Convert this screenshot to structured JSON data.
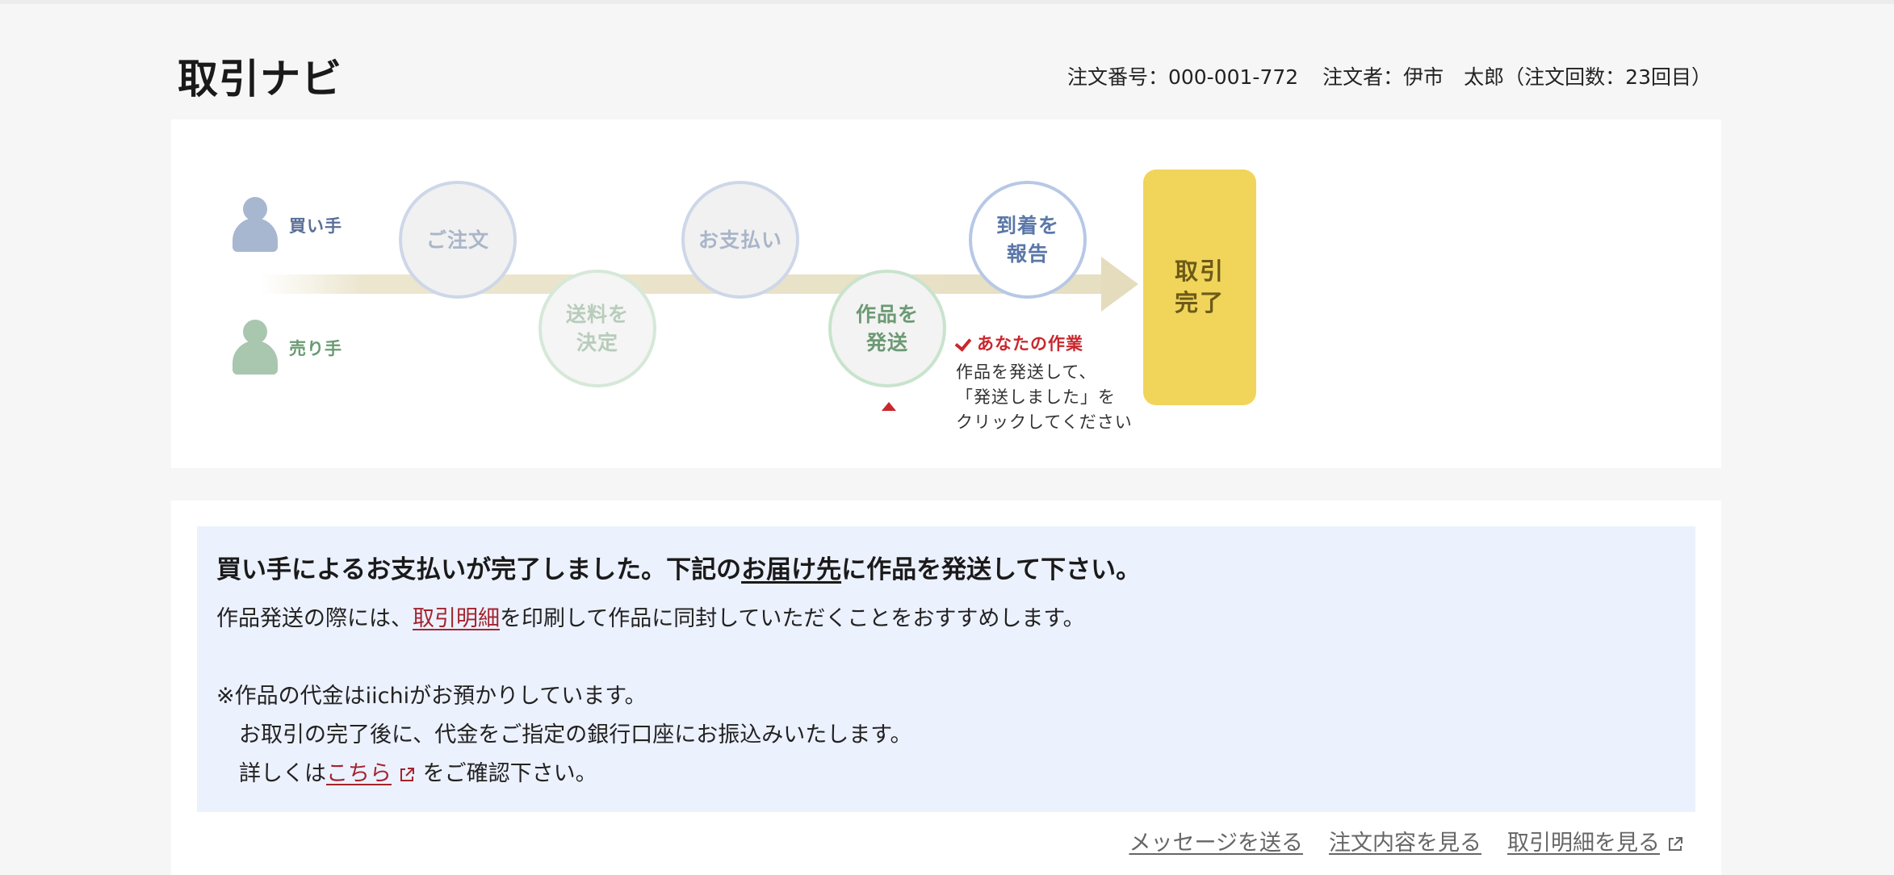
{
  "header": {
    "title": "取引ナビ",
    "order_number": "注文番号：000-001-772",
    "orderer": "注文者：伊市　太郎（注文回数：23回目）"
  },
  "flow": {
    "buyer_label": "買い手",
    "seller_label": "売り手",
    "steps": [
      {
        "label": "ご注文",
        "role": "buyer"
      },
      {
        "label": "送料を\n決定",
        "role": "seller"
      },
      {
        "label": "お支払い",
        "role": "buyer"
      },
      {
        "label": "作品を\n発送",
        "role": "seller",
        "current": true
      },
      {
        "label": "到着を\n報告",
        "role": "buyer"
      }
    ],
    "final_label": "取引\n完了",
    "task": {
      "title": "あなたの作業",
      "description": "作品を発送して、\n「発送しました」を\nクリックしてください"
    },
    "colors": {
      "final": "#f0d55a",
      "marker": "#c9272e"
    }
  },
  "notice": {
    "headline_pre": "買い手によるお支払いが完了しました。下記の",
    "headline_link": "お届け先",
    "headline_post": "に作品を発送して下さい。",
    "line1_pre": "作品発送の際には、",
    "line1_link": "取引明細",
    "line1_post": "を印刷して作品に同封していただくことをおすすめします。",
    "line2": "※作品の代金はiichiがお預かりしています。",
    "line3": "お取引の完了後に、代金をご指定の銀行口座にお振込みいたします。",
    "line4_pre": "詳しくは",
    "line4_link": "こちら",
    "line4_post": "をご確認下さい。",
    "background": "#ecf1fe",
    "link_color": "#a3242f"
  },
  "footer_links": {
    "send_message": "メッセージを送る",
    "view_order": "注文内容を見る",
    "view_statement": "取引明細を見る"
  }
}
